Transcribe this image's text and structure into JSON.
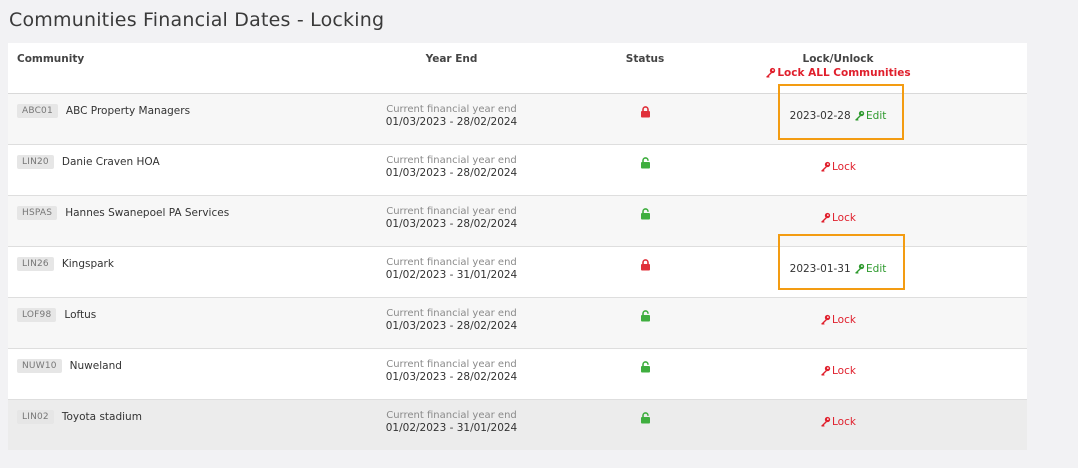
{
  "page": {
    "title": "Communities Financial Dates - Locking"
  },
  "table": {
    "headers": {
      "community": "Community",
      "year_end": "Year End",
      "status": "Status",
      "lock_unlock": "Lock/Unlock",
      "lock_all": "Lock ALL Communities"
    },
    "year_end_label": "Current financial year end",
    "lock_label": "Lock",
    "edit_label": "Edit",
    "rows": [
      {
        "code": "ABC01",
        "name": "ABC Property Managers",
        "year_end_label": "Current financial year end",
        "range": "01/03/2023 - 28/02/2024",
        "status": "locked",
        "locked_date": "2023-02-28",
        "action": "Edit"
      },
      {
        "code": "LIN20",
        "name": "Danie Craven HOA",
        "year_end_label": "Current financial year end",
        "range": "01/03/2023 - 28/02/2024",
        "status": "unlocked",
        "locked_date": "",
        "action": "Lock"
      },
      {
        "code": "HSPAS",
        "name": "Hannes Swanepoel PA Services",
        "year_end_label": "Current financial year end",
        "range": "01/03/2023 - 28/02/2024",
        "status": "unlocked",
        "locked_date": "",
        "action": "Lock"
      },
      {
        "code": "LIN26",
        "name": "Kingspark",
        "year_end_label": "Current financial year end",
        "range": "01/02/2023 - 31/01/2024",
        "status": "locked",
        "locked_date": "2023-01-31",
        "action": "Edit"
      },
      {
        "code": "LOF98",
        "name": "Loftus",
        "year_end_label": "Current financial year end",
        "range": "01/03/2023 - 28/02/2024",
        "status": "unlocked",
        "locked_date": "",
        "action": "Lock"
      },
      {
        "code": "NUW10",
        "name": "Nuweland",
        "year_end_label": "Current financial year end",
        "range": "01/03/2023 - 28/02/2024",
        "status": "unlocked",
        "locked_date": "",
        "action": "Lock"
      },
      {
        "code": "LIN02",
        "name": "Toyota stadium",
        "year_end_label": "Current financial year end",
        "range": "01/02/2023 - 31/01/2024",
        "status": "unlocked",
        "locked_date": "",
        "action": "Lock"
      }
    ]
  },
  "colors": {
    "locked": "#e0303a",
    "unlocked": "#3fae3f",
    "lock_link": "#e01f2c",
    "edit_link": "#2e9a2e",
    "highlight": "#f39c12"
  },
  "icons": {
    "locked": "padlock-closed-icon",
    "unlocked": "padlock-open-icon",
    "key": "key-icon"
  }
}
